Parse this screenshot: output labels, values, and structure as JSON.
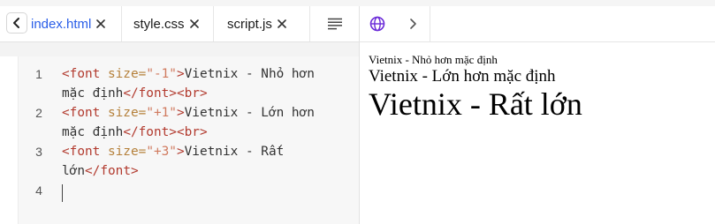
{
  "editor": {
    "tabs": [
      {
        "label": "index.html",
        "active": true
      },
      {
        "label": "style.css",
        "active": false
      },
      {
        "label": "script.js",
        "active": false
      }
    ],
    "icons": {
      "back": "chevron-left-icon",
      "close": "close-icon",
      "format": "format-lines-icon"
    },
    "line_numbers": [
      "1",
      "2",
      "3",
      "4"
    ],
    "code": {
      "l1a_open": "<font ",
      "l1a_attr": "size=",
      "l1a_val": "\"-1\"",
      "l1a_close": ">",
      "l1a_text": "Vietnix - Nhỏ hơn",
      "l1b_text": "mặc định",
      "l1b_tag": "</font><br>",
      "l2a_open": "<font ",
      "l2a_attr": "size=",
      "l2a_val": "\"+1\"",
      "l2a_close": ">",
      "l2a_text": "Vietnix - Lớn hơn",
      "l2b_text": "mặc định",
      "l2b_tag": "</font><br>",
      "l3a_open": "<font ",
      "l3a_attr": "size=",
      "l3a_val": "\"+3\"",
      "l3a_close": ">",
      "l3a_text": "Vietnix - Rất",
      "l3b_text": "lớn",
      "l3b_tag": "</font>"
    },
    "colors": {
      "tag": "#b23a2e",
      "attr": "#b5803a",
      "string": "#d07a5e",
      "active_tab": "#2a5ee8"
    }
  },
  "preview": {
    "icons": {
      "globe": "globe-icon",
      "forward": "chevron-right-icon"
    },
    "lines": {
      "small": "Vietnix - Nhỏ hơn mặc định",
      "medium": "Vietnix - Lớn hơn mặc định",
      "large": "Vietnix - Rất lớn"
    }
  }
}
